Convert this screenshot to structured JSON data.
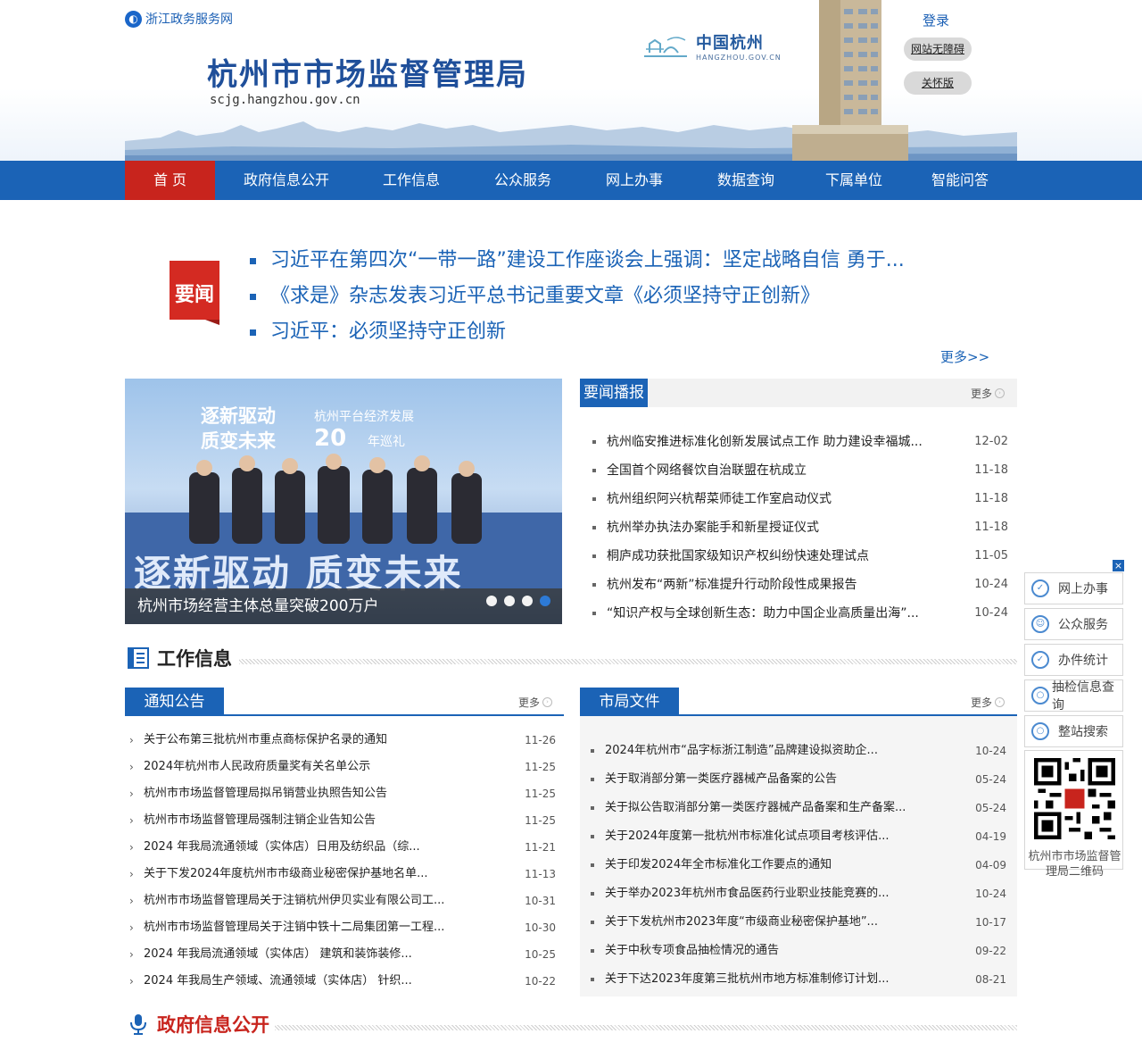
{
  "header": {
    "zj_link": "浙江政务服务网",
    "site_title": "杭州市市场监督管理局",
    "site_domain": "scjg.hangzhou.gov.cn",
    "hz_logo_cn": "中国杭州",
    "hz_logo_en": "HANGZHOU.GOV.CN",
    "login": "登录",
    "accessibility": "网站无障碍",
    "care_mode": "关怀版"
  },
  "nav": {
    "items": [
      "首  页",
      "政府信息公开",
      "工作信息",
      "公众服务",
      "网上办事",
      "数据查询",
      "下属单位",
      "智能问答"
    ]
  },
  "headlines": {
    "badge": "要闻",
    "items": [
      "习近平在第四次“一带一路”建设工作座谈会上强调：坚定战略自信 勇于...",
      "《求是》杂志发表习近平总书记重要文章《必须坚持守正创新》",
      "习近平：必须坚持守正创新"
    ],
    "more": "更多>>"
  },
  "carousel": {
    "banner_line1": "逐新驱动",
    "banner_line2": "质变未来",
    "banner_sub": "杭州平台经济发展",
    "banner_20": "20",
    "banner_20_suffix": "年巡礼",
    "banner_big": "逐新驱动 质变未来",
    "caption": "杭州市场经营主体总量突破200万户",
    "active_dot": 4
  },
  "news_broadcast": {
    "title": "要闻播报",
    "more": "更多",
    "items": [
      {
        "title": "杭州临安推进标准化创新发展试点工作 助力建设幸福城...",
        "date": "12-02"
      },
      {
        "title": "全国首个网络餐饮自治联盟在杭成立",
        "date": "11-18"
      },
      {
        "title": "杭州组织阿兴杭帮菜师徒工作室启动仪式",
        "date": "11-18"
      },
      {
        "title": "杭州举办执法办案能手和新星授证仪式",
        "date": "11-18"
      },
      {
        "title": "桐庐成功获批国家级知识产权纠纷快速处理试点",
        "date": "11-05"
      },
      {
        "title": "杭州发布“两新”标准提升行动阶段性成果报告",
        "date": "10-24"
      },
      {
        "title": "“知识产权与全球创新生态：助力中国企业高质量出海”...",
        "date": "10-24"
      }
    ]
  },
  "work_info": {
    "title": "工作信息",
    "notices": {
      "title": "通知公告",
      "more": "更多",
      "items": [
        {
          "title": "关于公布第三批杭州市重点商标保护名录的通知",
          "date": "11-26"
        },
        {
          "title": "2024年杭州市人民政府质量奖有关名单公示",
          "date": "11-25"
        },
        {
          "title": "杭州市市场监督管理局拟吊销营业执照告知公告",
          "date": "11-25"
        },
        {
          "title": "杭州市市场监督管理局强制注销企业告知公告",
          "date": "11-25"
        },
        {
          "title": "2024 年我局流通领域（实体店）日用及纺织品（综...",
          "date": "11-21"
        },
        {
          "title": "关于下发2024年度杭州市市级商业秘密保护基地名单...",
          "date": "11-13"
        },
        {
          "title": "杭州市市场监督管理局关于注销杭州伊贝实业有限公司工...",
          "date": "10-31"
        },
        {
          "title": "杭州市市场监督管理局关于注销中铁十二局集团第一工程...",
          "date": "10-30"
        },
        {
          "title": "2024 年我局流通领域（实体店） 建筑和装饰装修...",
          "date": "10-25"
        },
        {
          "title": "2024 年我局生产领域、流通领域（实体店） 针织...",
          "date": "10-22"
        }
      ]
    },
    "bureau_docs": {
      "title": "市局文件",
      "more": "更多",
      "items": [
        {
          "title": "2024年杭州市“品字标浙江制造”品牌建设拟资助企...",
          "date": "10-24"
        },
        {
          "title": "关于取消部分第一类医疗器械产品备案的公告",
          "date": "05-24"
        },
        {
          "title": "关于拟公告取消部分第一类医疗器械产品备案和生产备案...",
          "date": "05-24"
        },
        {
          "title": "关于2024年度第一批杭州市标准化试点项目考核评估...",
          "date": "04-19"
        },
        {
          "title": "关于印发2024年全市标准化工作要点的通知",
          "date": "04-09"
        },
        {
          "title": "关于举办2023年杭州市食品医药行业职业技能竞赛的...",
          "date": "10-24"
        },
        {
          "title": "关于下发杭州市2023年度“市级商业秘密保护基地”...",
          "date": "10-17"
        },
        {
          "title": "关于中秋专项食品抽检情况的通告",
          "date": "09-22"
        },
        {
          "title": "关于下达2023年度第三批杭州市地方标准制修订计划...",
          "date": "08-21"
        }
      ]
    }
  },
  "gov_info": {
    "title": "政府信息公开"
  },
  "float_bar": {
    "close": "×",
    "items": [
      "网上办事",
      "公众服务",
      "办件统计",
      "抽检信息查询",
      "整站搜索"
    ],
    "qr_caption": "杭州市市场监督管理局二维码"
  },
  "colors": {
    "primary_blue": "#1b63b6",
    "active_red": "#c8241d",
    "headline_blue": "#1b63b6"
  }
}
